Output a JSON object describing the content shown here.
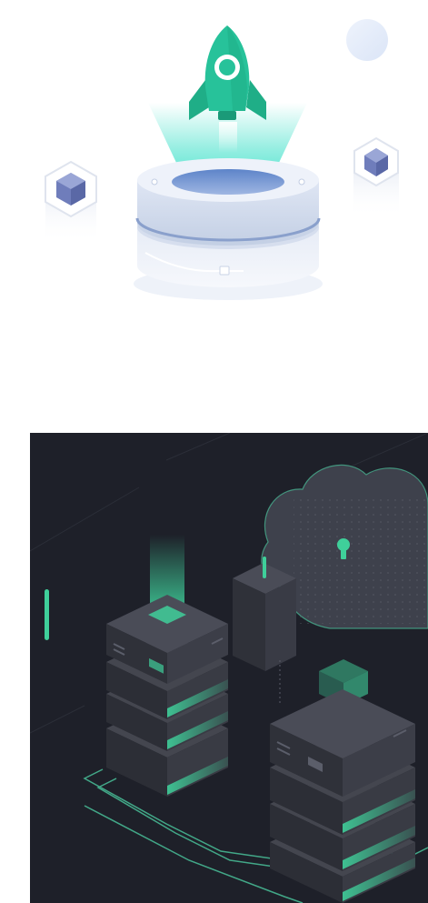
{
  "illustrations": [
    {
      "subject": "rocket-launch-from-database",
      "icon": "rocket-icon",
      "colors": {
        "rocket": "#27c29a",
        "beam": "#3ee0c9",
        "cylinder_top": "#dde6f5",
        "cylinder_side": "#c9d5ea",
        "cube": "#6f7dbb",
        "bubble": "#e8effb"
      }
    },
    {
      "subject": "server-racks-cloud",
      "icon": "server-rack-icon",
      "colors": {
        "background": "#1e2029",
        "rack_body": "#3a3c46",
        "rack_top": "#4a4c57",
        "accent": "#3fcf9a",
        "cloud": "#3e414c",
        "circuit": "#4fd6a8"
      }
    }
  ]
}
